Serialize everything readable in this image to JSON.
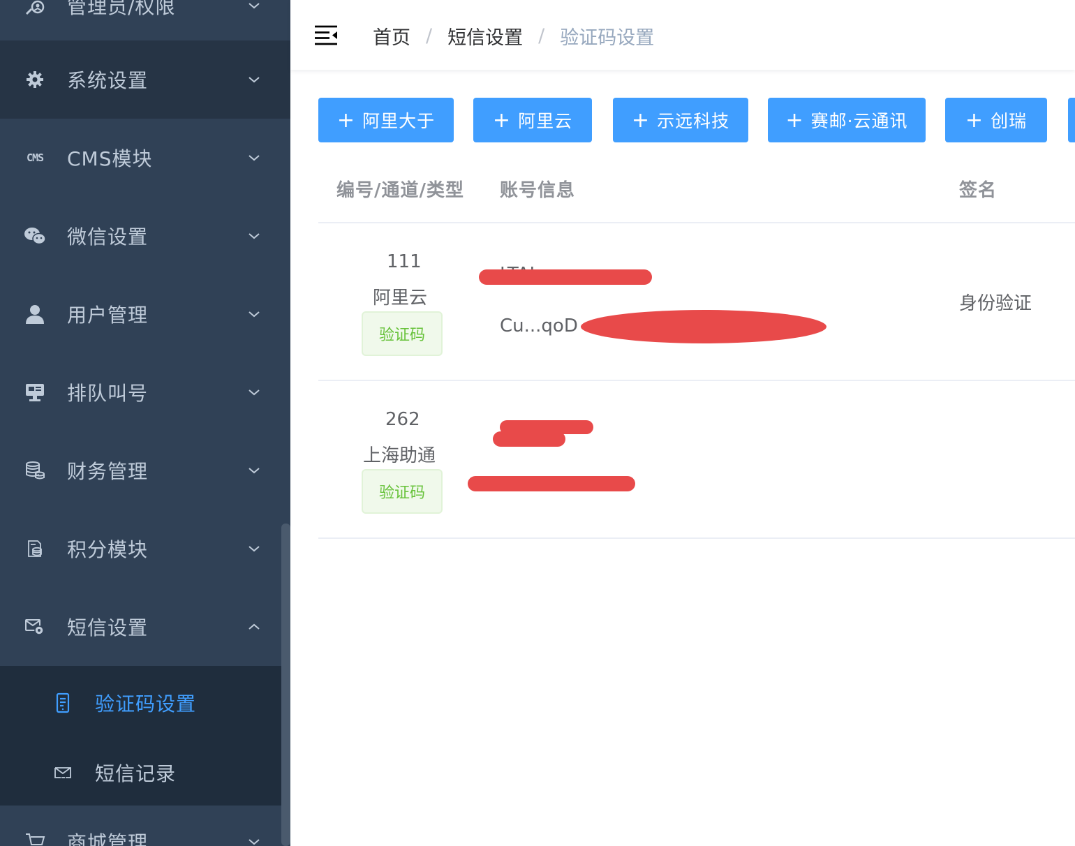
{
  "sidebar": {
    "items": [
      {
        "label": "管理员/权限",
        "icon": "admin-key-icon"
      },
      {
        "label": "系统设置",
        "icon": "gear-icon"
      },
      {
        "label": "CMS模块",
        "icon": "cms-icon",
        "icon_text": "CMS"
      },
      {
        "label": "微信设置",
        "icon": "wechat-icon"
      },
      {
        "label": "用户管理",
        "icon": "user-icon"
      },
      {
        "label": "排队叫号",
        "icon": "monitor-icon"
      },
      {
        "label": "财务管理",
        "icon": "coins-icon"
      },
      {
        "label": "积分模块",
        "icon": "points-icon"
      },
      {
        "label": "短信设置",
        "icon": "sms-settings-icon"
      },
      {
        "label": "商城管理",
        "icon": "cart-icon"
      }
    ],
    "sub_items": [
      {
        "label": "验证码设置",
        "icon": "phone-icon",
        "active": true
      },
      {
        "label": "短信记录",
        "icon": "mail-icon",
        "active": false
      }
    ]
  },
  "navbar": {
    "breadcrumb": [
      "首页",
      "短信设置",
      "验证码设置"
    ],
    "separator": "/"
  },
  "toolbar": {
    "plus": "+",
    "buttons": [
      "阿里大于",
      "阿里云",
      "示远科技",
      "赛邮·云通讯",
      "创瑞"
    ]
  },
  "table": {
    "headers": [
      "编号/通道/类型",
      "账号信息",
      "签名"
    ],
    "rows": [
      {
        "id": "111",
        "channel": "阿里云",
        "type": "验证码",
        "account_line1": "LTAI...",
        "account_line2": "Cu...qoD",
        "signature": "身份验证"
      },
      {
        "id": "262",
        "channel": "上海助通",
        "type": "验证码",
        "account_line1": "",
        "account_line2": "",
        "signature": ""
      }
    ]
  },
  "colors": {
    "sidebar_bg": "#304156",
    "sidebar_active": "#409eff",
    "primary": "#409eff",
    "tag_green": "#67c23a",
    "redaction": "#e84a4a"
  }
}
